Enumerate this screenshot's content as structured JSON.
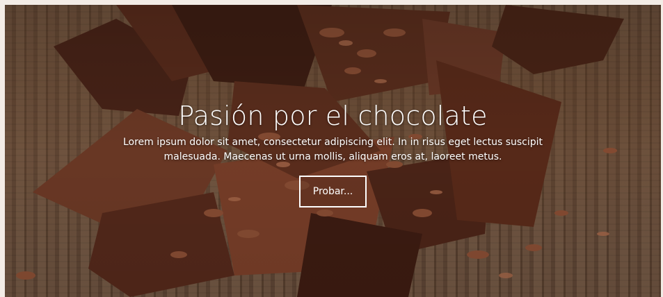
{
  "hero": {
    "title": "Pasión por el chocolate",
    "subtitle": "Lorem ipsum dolor sit amet, consectetur adipiscing elit. In in risus eget lectus suscipit malesuada. Maecenas ut urna mollis, aliquam eros at, laoreet metus.",
    "cta_label": "Probar..."
  }
}
